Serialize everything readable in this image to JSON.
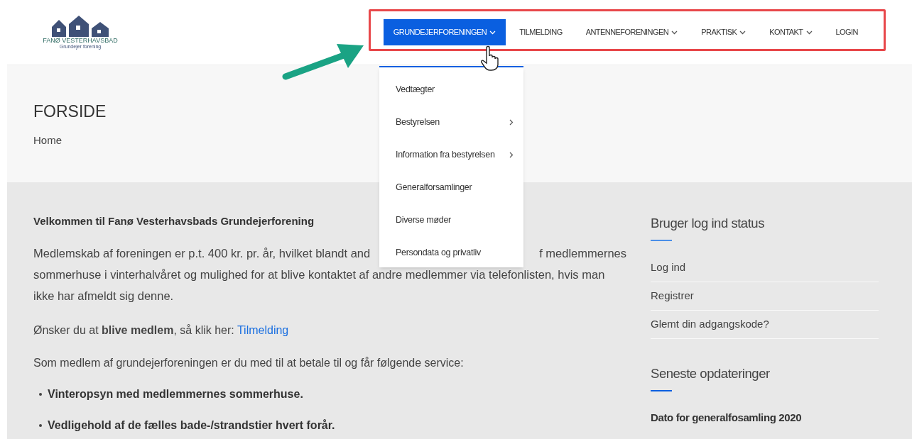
{
  "logo": {
    "name": "FANØ VESTERHAVSBAD",
    "subtitle": "Grundejer forening"
  },
  "nav": [
    {
      "label": "GRUNDEJERFORENINGEN",
      "has_caret": true,
      "selected": true
    },
    {
      "label": "TILMELDING",
      "has_caret": false,
      "selected": false
    },
    {
      "label": "ANTENNEFORENINGEN",
      "has_caret": true,
      "selected": false
    },
    {
      "label": "PRAKTISK",
      "has_caret": true,
      "selected": false
    },
    {
      "label": "KONTAKT",
      "has_caret": true,
      "selected": false
    },
    {
      "label": "LOGIN",
      "has_caret": false,
      "selected": false
    }
  ],
  "dropdown": [
    {
      "label": "Vedtægter",
      "has_submenu": false
    },
    {
      "label": "Bestyrelsen",
      "has_submenu": true
    },
    {
      "label": "Information fra bestyrelsen",
      "has_submenu": true
    },
    {
      "label": "Generalforsamlinger",
      "has_submenu": false
    },
    {
      "label": "Diverse møder",
      "has_submenu": false
    },
    {
      "label": "Persondata og privatliv",
      "has_submenu": false
    }
  ],
  "page_title": "FORSIDE",
  "breadcrumb": "Home",
  "content": {
    "heading": "Velkommen til Fanø Vesterhavsbads Grundejerforening",
    "intro_lines": [
      [
        "Medlemskab af foreningen er p.t. 400 kr. pr. år, hvilket blandt and",
        "f medlemmernes"
      ],
      [
        "sommerhuse i vinterhalvåret og mulighed for at blive kontaktet af andre medlemmer via telefonlisten, hvis man"
      ],
      [
        "ikke har afmeldt sig denne."
      ]
    ],
    "join_text": "Ønsker du at **blive medlem**, så klik her: ",
    "join_link": "Tilmelding",
    "services_intro": "Som medlem af grundejerforeningen er du med til at betale til og får følgende service:",
    "services": [
      "Vinteropsyn med medlemmernes sommerhuse.",
      "Vedligehold af de fælles bade-/strandstier hvert forår."
    ]
  },
  "sidebar": {
    "login_title": "Bruger log ind status",
    "login_links": [
      "Log ind",
      "Registrer",
      "Glemt din adgangskode?"
    ],
    "updates_title": "Seneste opdateringer",
    "updates": [
      "Dato for generalfosamling 2020"
    ]
  }
}
